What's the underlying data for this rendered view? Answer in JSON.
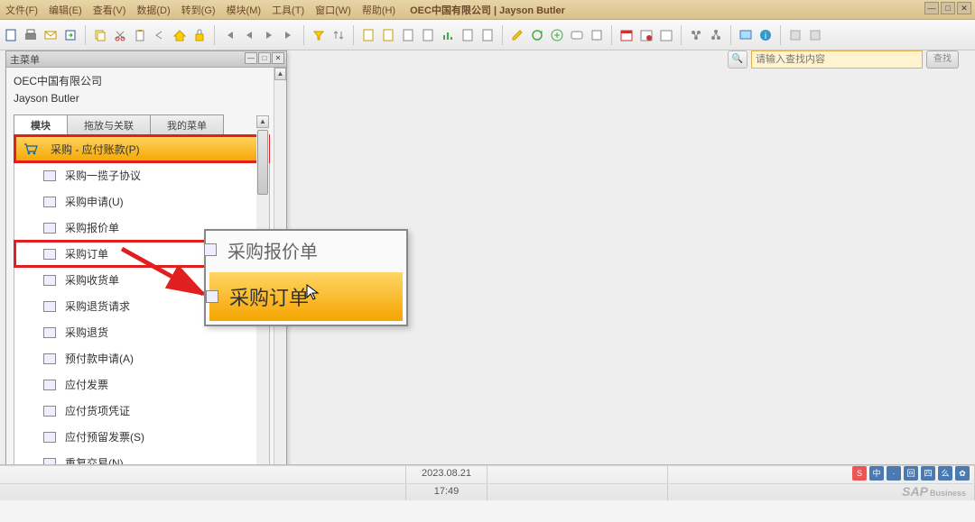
{
  "menubar": {
    "items": [
      "文件(F)",
      "编辑(E)",
      "查看(V)",
      "数据(D)",
      "转到(G)",
      "模块(M)",
      "工具(T)",
      "窗口(W)",
      "帮助(H)"
    ],
    "title": "OEC中国有限公司 | Jayson Butler",
    "win": [
      "—",
      "□",
      "✕"
    ]
  },
  "search": {
    "placeholder": "请输入查找内容",
    "go": "查找",
    "icon": "🔍"
  },
  "panel": {
    "title": "主菜单",
    "company": "OEC中国有限公司",
    "user": "Jayson Butler",
    "tabs": [
      "模块",
      "拖放与关联",
      "我的菜单"
    ],
    "header": "采购 - 应付账款(P)",
    "items": [
      "采购一揽子协议",
      "采购申请(U)",
      "采购报价单",
      "采购订单",
      "采购收货单",
      "采购退货请求",
      "采购退货",
      "预付款申请(A)",
      "应付发票",
      "应付货项凭证",
      "应付预留发票(S)",
      "重复交易(N)"
    ],
    "pcontrols": [
      "—",
      "□",
      "✕"
    ]
  },
  "zoom": {
    "row1": "采购报价单",
    "row2": "采购订单"
  },
  "status": {
    "date": "2023.08.21",
    "time": "17:49"
  },
  "logo": {
    "brand": "SAP",
    "sub": "Business"
  },
  "ime": [
    "S",
    "中",
    "·",
    "回",
    "四",
    "么",
    "✿"
  ],
  "colors": {
    "ime": [
      "#e03030",
      "#4a7ab0",
      "#4a7ab0",
      "#4a7ab0",
      "#4a7ab0",
      "#4a7ab0",
      "#4a7ab0"
    ]
  }
}
